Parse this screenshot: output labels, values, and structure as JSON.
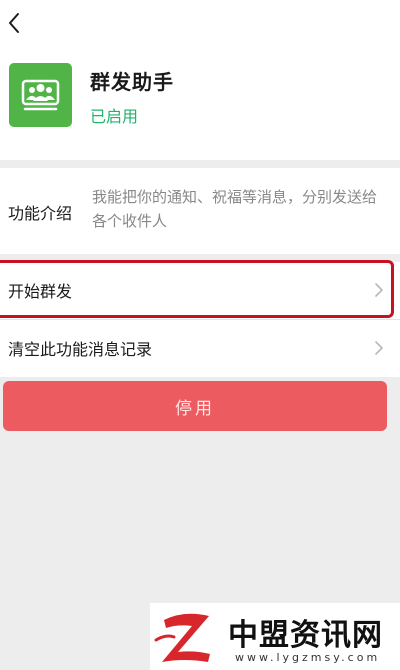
{
  "header": {
    "back_icon": "chevron-left-icon"
  },
  "app": {
    "icon": "group-users-icon",
    "icon_color": "#50b446",
    "name": "群发助手",
    "status": "已启用",
    "status_color": "#21b36d"
  },
  "intro": {
    "label": "功能介绍",
    "text": "我能把你的通知、祝福等消息，分别发送给各个收件人"
  },
  "menu": {
    "items": [
      {
        "label": "开始群发",
        "icon": "chevron-right-icon",
        "highlighted": true
      },
      {
        "label": "清空此功能消息记录",
        "icon": "chevron-right-icon",
        "highlighted": false
      }
    ]
  },
  "actions": {
    "disable_label": "停用",
    "disable_color": "#ec5b5f"
  },
  "watermark": {
    "brand": "中盟资讯网",
    "url": "www.lygzmsy.com",
    "logo_color": "#d7262c"
  }
}
